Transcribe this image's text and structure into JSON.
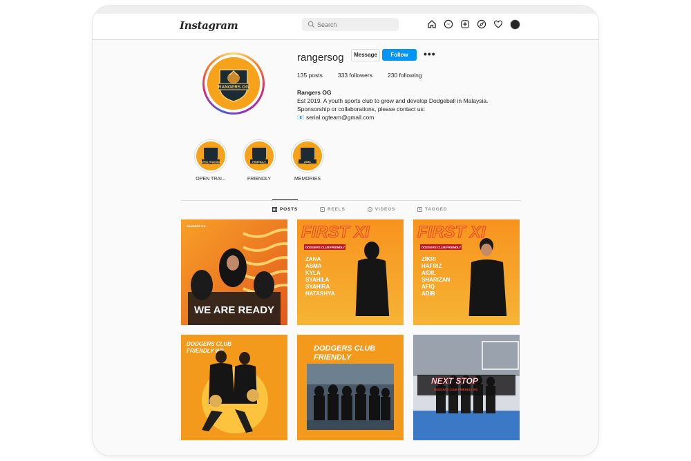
{
  "nav": {
    "logo": "Instagram",
    "search_placeholder": "Search",
    "icons": [
      "home-icon",
      "messenger-icon",
      "new-post-icon",
      "explore-icon",
      "heart-icon",
      "avatar"
    ]
  },
  "profile": {
    "username": "rangersog",
    "message_label": "Message",
    "follow_label": "Follow",
    "more_label": "•••",
    "stats": {
      "posts": "135 posts",
      "followers": "333 followers",
      "following": "230 following"
    },
    "bio": {
      "name": "Rangers OG",
      "line1": "Est 2019. A youth sports club to grow and develop Dodgeball in Malaysia.",
      "line2": "Sponsorship or collaborations, please contact us:",
      "email": "📧 serial.ogteam@gmail.com"
    },
    "logo_text": "RANGERS OG"
  },
  "highlights": [
    {
      "label": "OPEN TRAI...",
      "img_text": "OPEN TRAINING"
    },
    {
      "label": "FRIENDLY",
      "img_text": "FRIENDLY"
    },
    {
      "label": "MEMORIES",
      "img_text": "2021"
    }
  ],
  "tabs": [
    {
      "label": "POSTS",
      "active": true
    },
    {
      "label": "REELS",
      "active": false
    },
    {
      "label": "VIDEOS",
      "active": false
    },
    {
      "label": "TAGGED",
      "active": false
    }
  ],
  "posts": [
    {
      "title": "WE ARE READY",
      "top": "RANGERS OG"
    },
    {
      "title": "FIRST XI",
      "sub": "DODGERS CLUB FRIENDLY",
      "names": [
        "ZANA",
        "ASMA",
        "KYLA",
        "SYAHILA",
        "SYAHIRA",
        "NATASHYA"
      ]
    },
    {
      "title": "FIRST XI",
      "sub": "DODGERS CLUB FRIENDLY",
      "names": [
        "ZIKRI",
        "HAFRIZ",
        "AIDIL",
        "SHARIZAN",
        "AFIQ",
        "ADIB"
      ]
    },
    {
      "title": "DODGERS CLUB",
      "title2": "FRIENDLY W2"
    },
    {
      "title": "DODGERS CLUB",
      "title2": "FRIENDLY"
    },
    {
      "title": "NEXT STOP",
      "sub": "DODGERS CLUB FRIENDLY W2"
    }
  ],
  "colors": {
    "accent": "#0095f6",
    "orange": "#f7a21b",
    "red_title": "#e8412a"
  }
}
